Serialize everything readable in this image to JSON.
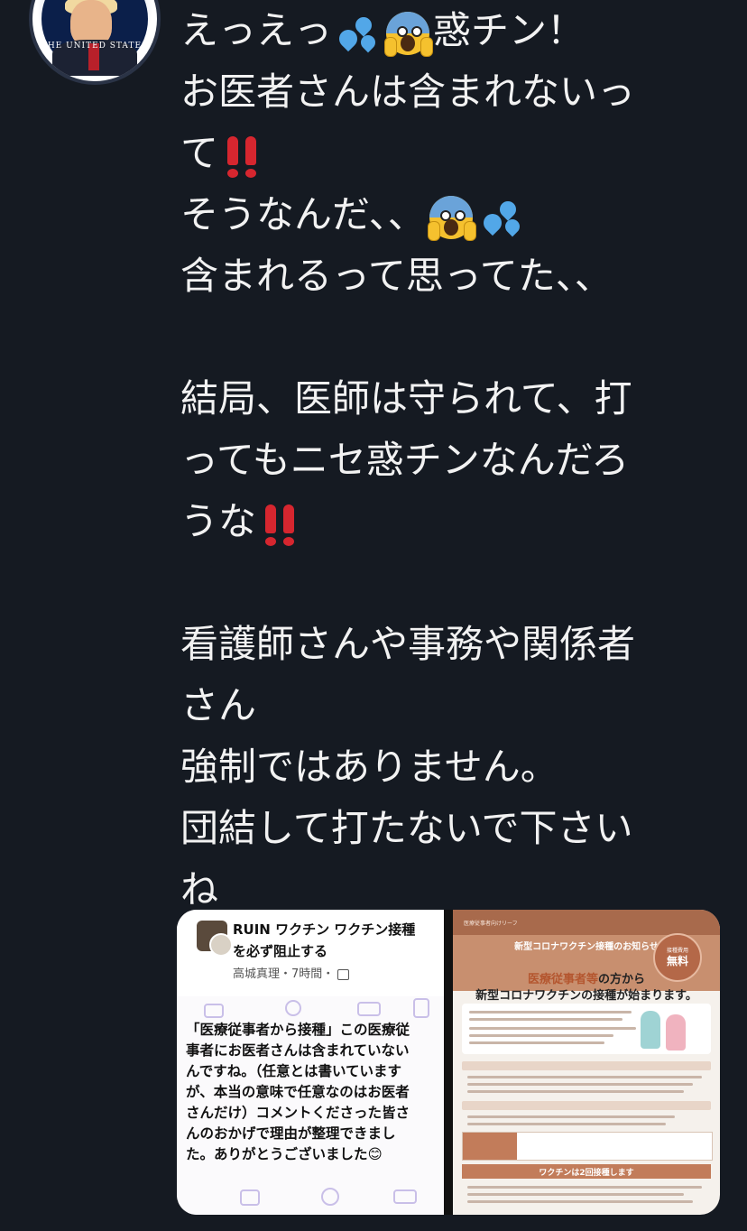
{
  "tweet": {
    "lines": [
      [
        "えっえっ",
        "sweat-droplets-emoji",
        "scream-emoji",
        "惑チン！"
      ],
      [
        "お医者さんは含まれないっ"
      ],
      [
        "て",
        "double-exclamation-emoji"
      ],
      [
        "そうなんだ、、",
        "scream-emoji",
        "sweat-droplets-emoji"
      ],
      [
        "含まれるって思ってた、、"
      ],
      [
        ""
      ],
      [
        "結局、医師は守られて、打"
      ],
      [
        "ってもニセ惑チンなんだろ"
      ],
      [
        "うな",
        "double-exclamation-emoji"
      ],
      [
        ""
      ],
      [
        "看護師さんや事務や関係者"
      ],
      [
        "さん"
      ],
      [
        "強制ではありません。"
      ],
      [
        "団結して打たないで下さい"
      ],
      [
        "ね"
      ]
    ]
  },
  "avatar": {
    "motto": "THE UNITED STATES"
  },
  "media": {
    "left": {
      "title": "RUIN ワクチン ワクチン接種を必ず阻止する",
      "title_line1": "RUIN ワクチン ワクチン接種",
      "title_line2": "を必ず阻止する",
      "meta": "高城真理・7時間・",
      "body_lines": [
        "「医療従事者から接種」この医療従",
        "事者にお医者さんは含まれていない",
        "んですね。（任意とは書いています",
        "が、本当の意味で任意なのはお医者",
        "さんだけ）コメントくださった皆さ",
        " んのおかげで理由が整理できまし",
        "  た。ありがとうございました😊"
      ]
    },
    "right": {
      "small_header": "医療従事者向けリーフ",
      "headline": "新型コロナワクチン接種のお知らせ",
      "badge_top": "接種費用",
      "badge_main": "無料",
      "hl1_accent": "医療従事者等",
      "hl1_rest": "の方から",
      "hl2": "新型コロナワクチンの接種が始まります。",
      "bottom_bar": "ワクチンは2回接種します"
    }
  },
  "colors": {
    "background": "#151a22",
    "text": "#f2f2f2",
    "accent_doc": "#c27c5a"
  }
}
